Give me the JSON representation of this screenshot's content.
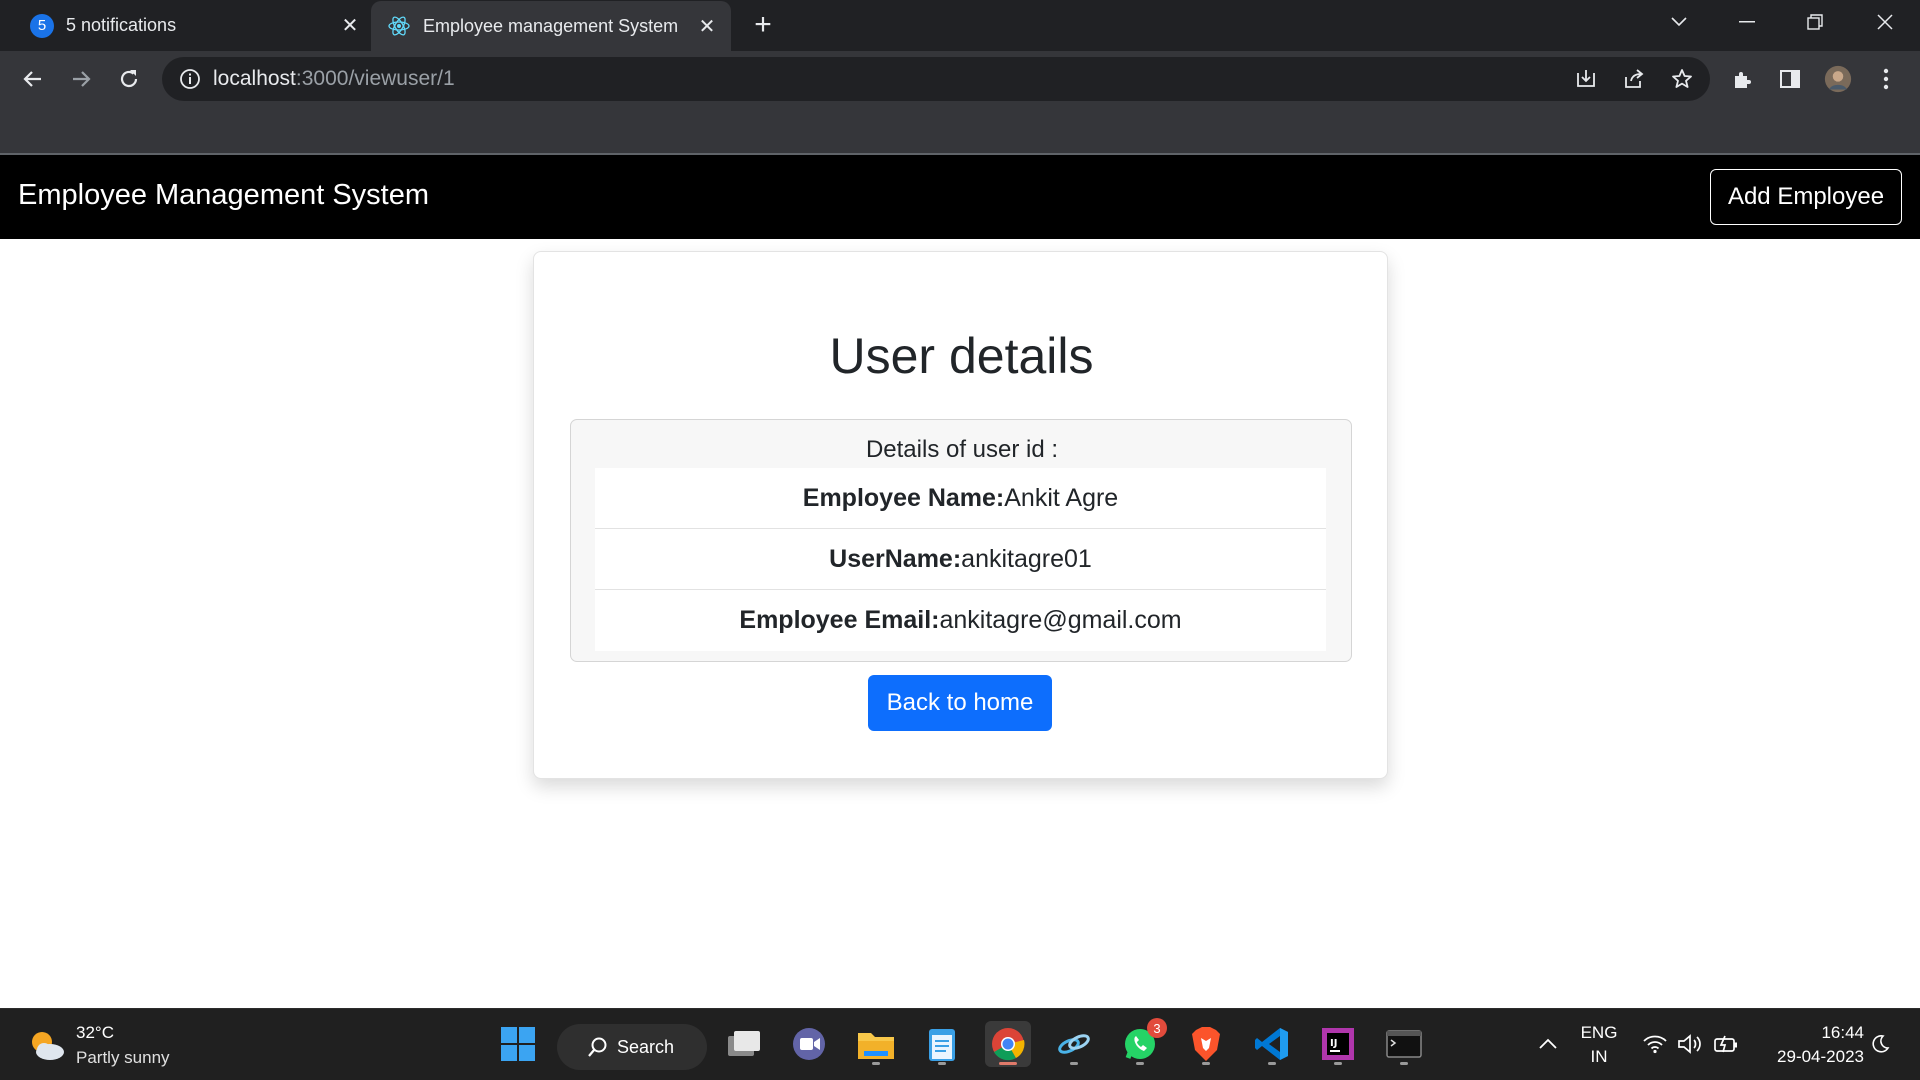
{
  "browser": {
    "tabs": [
      {
        "label": "5 notifications",
        "badge": "5"
      },
      {
        "label": "Employee management System"
      }
    ],
    "url_host": "localhost",
    "url_rest": ":3000/viewuser/1"
  },
  "navbar": {
    "brand": "Employee Management System",
    "add_button": "Add Employee"
  },
  "card": {
    "title": "User details",
    "header": "Details of user id :",
    "items": [
      {
        "label": "Employee Name:",
        "value": "Ankit Agre"
      },
      {
        "label": "UserName:",
        "value": "ankitagre01"
      },
      {
        "label": "Employee Email:",
        "value": "ankitagre@gmail.com"
      }
    ],
    "back_button": "Back to home"
  },
  "taskbar": {
    "weather_temp": "32°C",
    "weather_desc": "Partly sunny",
    "search_label": "Search",
    "whatsapp_badge": "3",
    "lang": "ENG",
    "region": "IN",
    "time": "16:44",
    "date": "29-04-2023"
  },
  "colors": {
    "primary": "#0d6efd",
    "navbar": "#000000",
    "chrome_dark": "#202124",
    "chrome_toolbar": "#35363a",
    "taskbar": "#202020"
  }
}
